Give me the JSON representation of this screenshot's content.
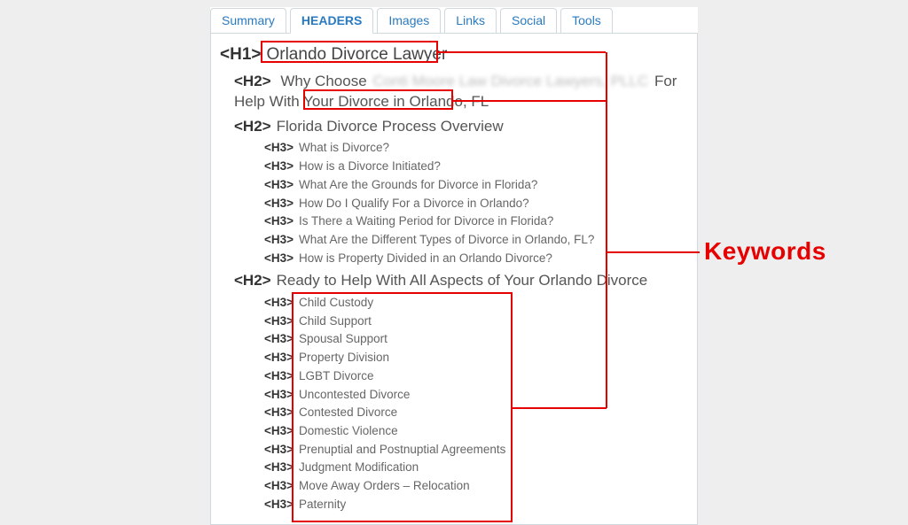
{
  "tabs": {
    "summary": "Summary",
    "headers": "HEADERS",
    "images": "Images",
    "links": "Links",
    "social": "Social",
    "tools": "Tools"
  },
  "annotation": {
    "keywords_label": "Keywords"
  },
  "headers": {
    "h1": "Orlando Divorce Lawyer",
    "h2_1_pre": "Why Choose ",
    "h2_1_blur": "Conti Moore Law Divorce Lawyers, PLLC",
    "h2_1_post": " For Help With Your ",
    "h2_1_tail": "Divorce in Orlando, FL",
    "h2_2": "Florida Divorce Process Overview",
    "h3_a": [
      "What is Divorce?",
      "How is a Divorce Initiated?",
      "What Are the Grounds for Divorce in Florida?",
      "How Do I Qualify For a Divorce in Orlando?",
      "Is There a Waiting Period for Divorce in Florida?",
      "What Are the Different Types of Divorce in Orlando, FL?",
      "How is Property Divided in an Orlando Divorce?"
    ],
    "h2_3": "Ready to Help With All Aspects of Your Orlando Divorce",
    "h3_b": [
      "Child Custody",
      "Child Support",
      "Spousal Support",
      "Property Division",
      "LGBT Divorce",
      "Uncontested Divorce",
      "Contested Divorce",
      "Domestic Violence",
      "Prenuptial and Postnuptial Agreements",
      "Judgment Modification",
      "Move Away Orders – Relocation",
      "Paternity"
    ],
    "tag_h1": "<H1>",
    "tag_h2": "<H2>",
    "tag_h3": "<H3>"
  }
}
